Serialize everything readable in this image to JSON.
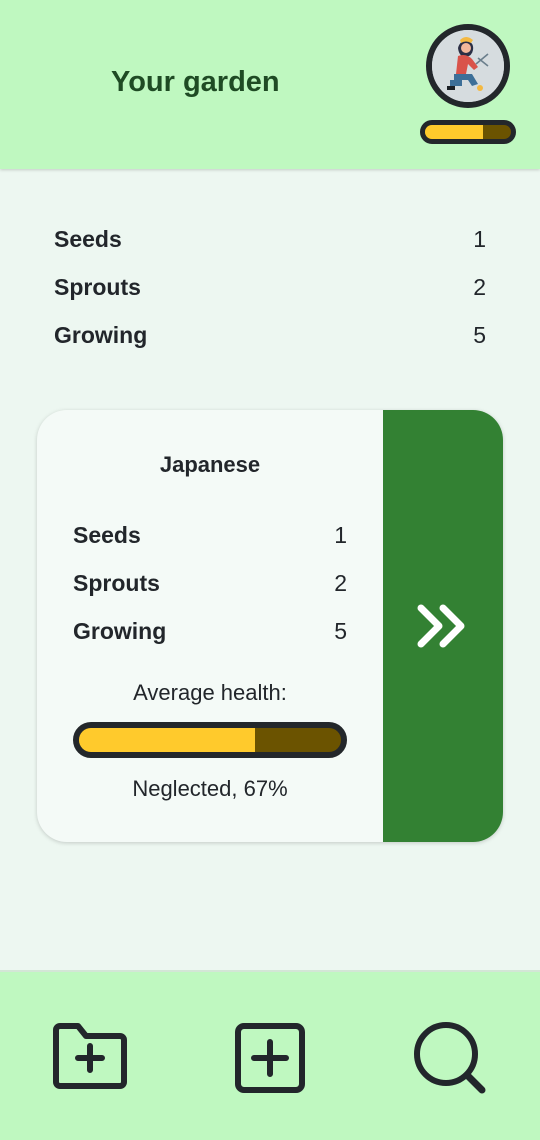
{
  "header": {
    "title": "Your garden",
    "avatar_icon": "gardener-avatar-icon",
    "health_level": 0.67
  },
  "summary": {
    "items": [
      {
        "label": "Seeds",
        "value": "1"
      },
      {
        "label": "Sprouts",
        "value": "2"
      },
      {
        "label": "Growing",
        "value": "5"
      }
    ]
  },
  "garden_card": {
    "title": "Japanese",
    "items": [
      {
        "label": "Seeds",
        "value": "1"
      },
      {
        "label": "Sprouts",
        "value": "2"
      },
      {
        "label": "Growing",
        "value": "5"
      }
    ],
    "health_label": "Average health:",
    "health_level": 0.67,
    "status": "Neglected, 67%",
    "open_icon": "double-chevron-right-icon"
  },
  "nav": {
    "icons": [
      "folder-add-icon",
      "add-square-icon",
      "search-icon"
    ]
  },
  "colors": {
    "header_bg": "#bff8c0",
    "page_bg": "#edf7f1",
    "accent_green": "#338133",
    "health_fill": "#ffca2c",
    "health_empty": "#6b5300"
  }
}
